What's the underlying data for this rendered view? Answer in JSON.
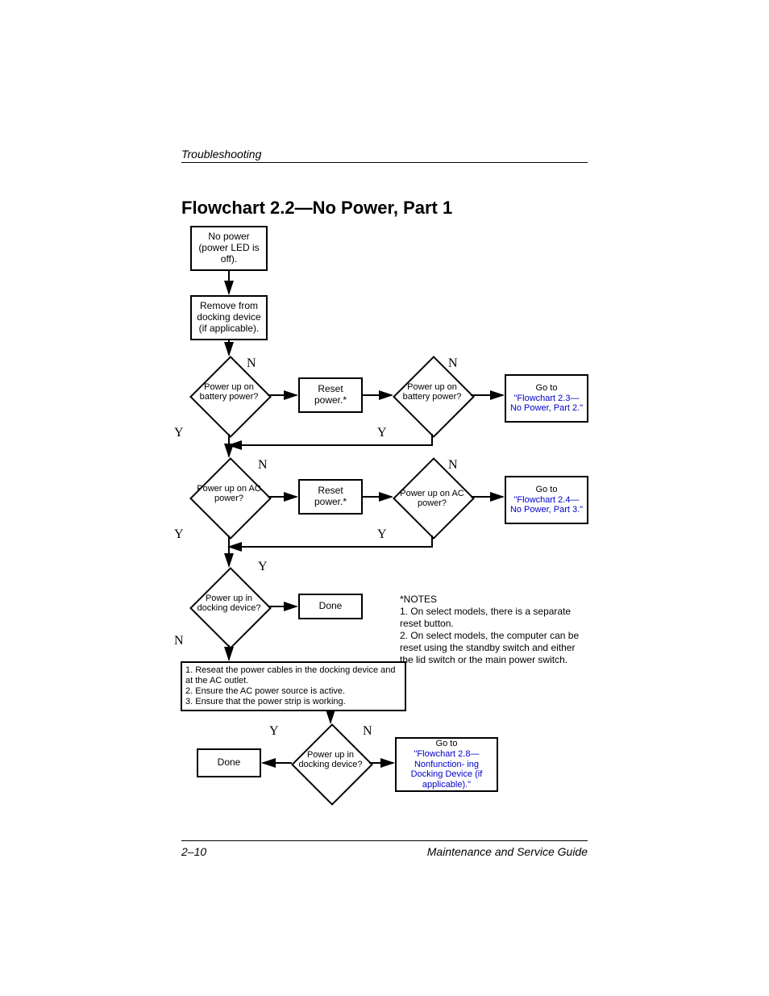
{
  "header": {
    "section": "Troubleshooting"
  },
  "title": "Flowchart 2.2—No Power, Part 1",
  "footer": {
    "page": "2–10",
    "guide": "Maintenance and Service Guide"
  },
  "nodes": {
    "start": "No power (power LED is off).",
    "undock": "Remove from docking device (if applicable).",
    "q_batt1": "Power up on battery power?",
    "reset1": "Reset power.*",
    "q_batt2": "Power up on battery power?",
    "goto23_a": "Go to",
    "goto23_b": "\"Flowchart 2.3—No Power, Part 2.\"",
    "q_ac1": "Power up on AC power?",
    "reset2": "Reset power.*",
    "q_ac2": "Power up on AC power?",
    "goto24_a": "Go to",
    "goto24_b": "\"Flowchart 2.4—No Power, Part 3.\"",
    "q_dock1": "Power up in docking device?",
    "done1": "Done",
    "steps": "1. Reseat the power cables in the docking device and at the AC outlet.\n2. Ensure the AC power source is active.\n3. Ensure that the power strip is working.",
    "q_dock2": "Power up in docking device?",
    "done2": "Done",
    "goto28_a": "Go to",
    "goto28_b": "\"Flowchart 2.8—Nonfunction- ing Docking Device (if applicable).\""
  },
  "yn": {
    "Y": "Y",
    "N": "N"
  },
  "notes": {
    "head": "*NOTES",
    "n1": "1. On select models, there is a separate reset button.",
    "n2": "2. On select models, the computer can be reset using the standby switch and either the lid switch or the main power switch."
  }
}
